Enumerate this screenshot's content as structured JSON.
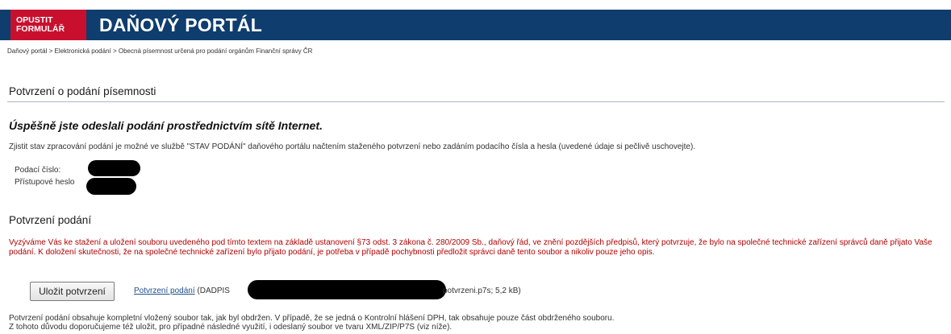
{
  "header": {
    "exit_line1": "OPUSTIT",
    "exit_line2": "FORMULÁŘ",
    "title": "DAŇOVÝ PORTÁL",
    "bar_color": "#0e3d6e",
    "exit_color": "#c8102e"
  },
  "breadcrumb": {
    "items": [
      "Daňový portál",
      "Elektronická podání",
      "Obecná písemnost určená pro podání orgánům Finanční správy ČR"
    ],
    "separator": " > "
  },
  "main": {
    "section_title": "Potvrzení o podání písemnosti",
    "success_message": "Úspěšně jste odeslali podání prostřednictvím sítě Internet.",
    "info_text": "Zjistit stav zpracování podání je možné ve službě \"STAV PODÁNÍ\" daňového portálu načtením staženého potvrzení nebo zadáním podacího čísla a hesla (uvedené údaje si pečlivě uschovejte).",
    "fields": [
      {
        "label": "Podací číslo:"
      },
      {
        "label": "Přístupové heslo"
      }
    ]
  },
  "confirmation": {
    "title": "Potvrzení podání",
    "warning_text": "Vyzýváme Vás ke stažení a uložení souboru uvedeného pod tímto textem na základě ustanovení §73 odst. 3 zákona č. 280/2009 Sb., daňový řád, ve znění pozdějších předpisů, který potvrzuje, že bylo na společné technické zařízení správců daně přijato Vaše podání. K doložení skutečnosti, že na společné technické zařízení bylo přijato podání, je potřeba v případě pochybnosti předložit správci daně tento soubor a nikoliv pouze jeho opis.",
    "warning_color": "#b00000",
    "save_button": "Uložit potvrzení",
    "file_link": "Potvrzení podání",
    "file_prefix": "(DADPIS",
    "file_suffix": "potvrzeni.p7s; 5,2 kB)",
    "note_line1": "Potvrzení podání obsahuje kompletní vložený soubor tak, jak byl obdržen. V případě, že se jedná o Kontrolní hlášení DPH, tak obsahuje pouze část obdrženého souboru.",
    "note_line2": "Z tohoto důvodu doporučujeme též uložit, pro případné následné využití, i odeslaný soubor ve tvaru XML/ZIP/P7S (viz níže)."
  }
}
